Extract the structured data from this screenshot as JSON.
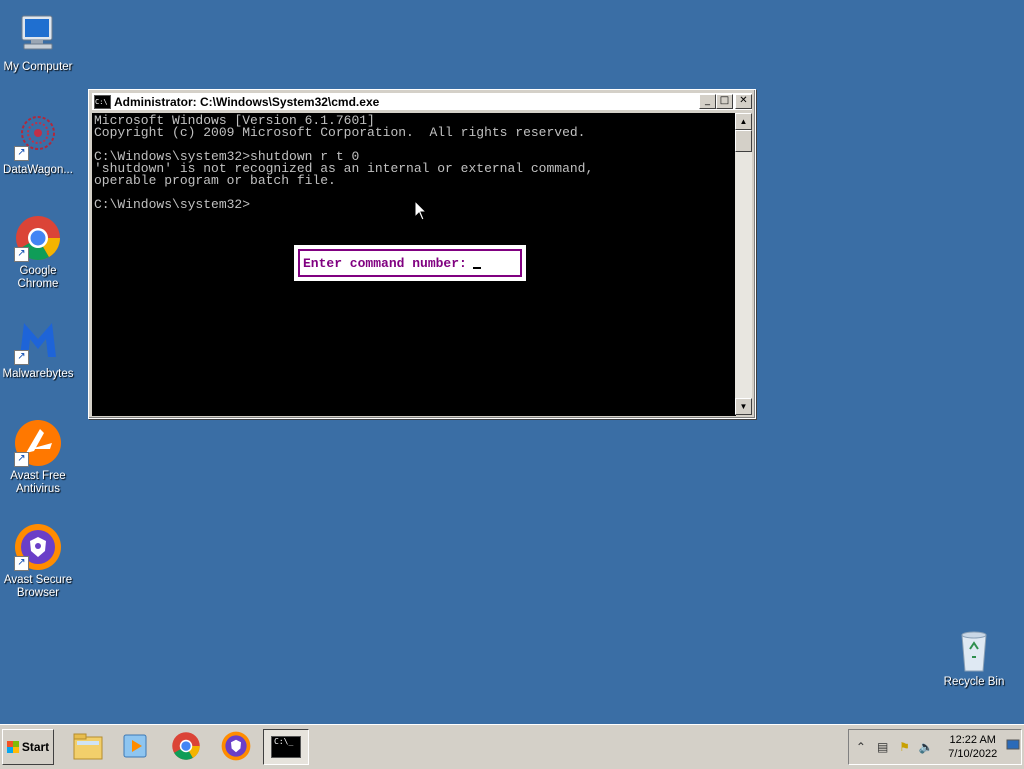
{
  "desktop": {
    "icons": [
      {
        "label": "My Computer"
      },
      {
        "label": "DataWagon..."
      },
      {
        "label": "Google Chrome"
      },
      {
        "label": "Malwarebytes"
      },
      {
        "label": "Avast Free Antivirus"
      },
      {
        "label": "Avast Secure Browser"
      },
      {
        "label": "Recycle Bin"
      }
    ]
  },
  "cmd": {
    "title": "Administrator: C:\\Windows\\System32\\cmd.exe",
    "lines": [
      "Microsoft Windows [Version 6.1.7601]",
      "Copyright (c) 2009 Microsoft Corporation.  All rights reserved.",
      "",
      "C:\\Windows\\system32>shutdown r t 0",
      "'shutdown' is not recognized as an internal or external command,",
      "operable program or batch file.",
      "",
      "C:\\Windows\\system32>"
    ],
    "sys_icon_text": "C:\\",
    "minimize": "_",
    "maximize": "□",
    "close": "✕"
  },
  "prompt": {
    "label": "Enter command number:"
  },
  "taskbar": {
    "start_label": "Start",
    "clock_time": "12:22 AM",
    "clock_date": "7/10/2022",
    "cmd_icon_text": "C:\\_"
  }
}
